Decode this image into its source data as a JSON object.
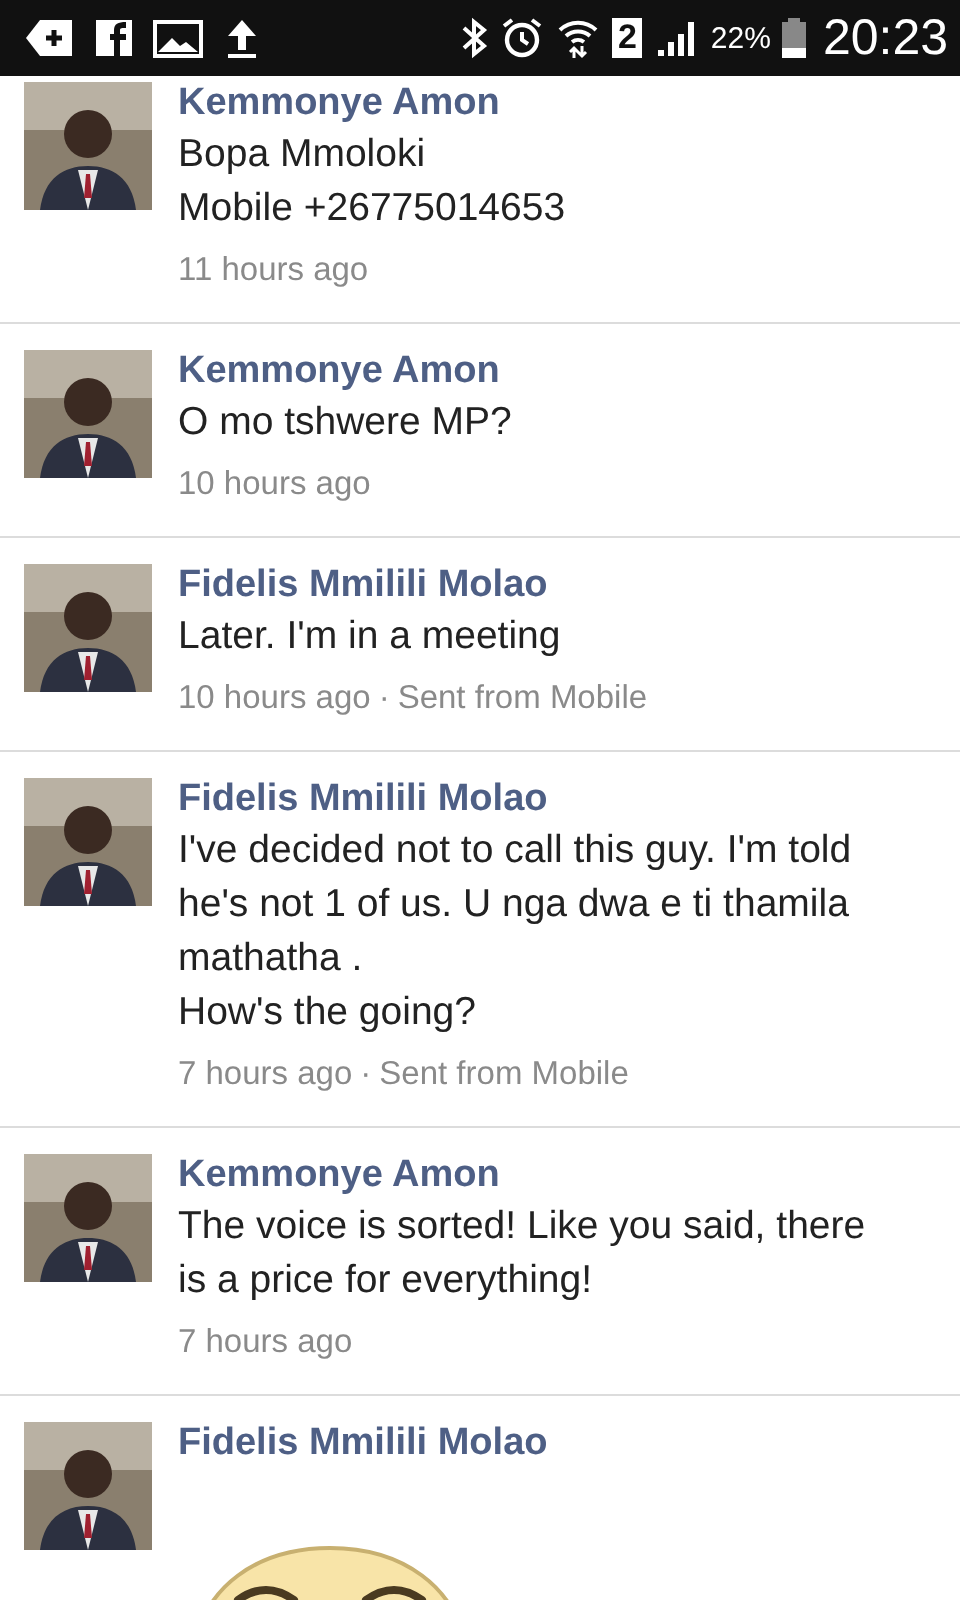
{
  "status_bar": {
    "sim": "2",
    "battery": "22%",
    "time": "20:23"
  },
  "messages": [
    {
      "kind": "text",
      "author": "Kemmonye Amon",
      "lines": [
        "Bopa Mmoloki",
        "Mobile +26775014653"
      ],
      "time": "11 hours ago"
    },
    {
      "kind": "text",
      "author": "Kemmonye Amon",
      "lines": [
        "O mo tshwere MP?"
      ],
      "time": "10 hours ago"
    },
    {
      "kind": "text",
      "author": "Fidelis Mmilili Molao",
      "lines": [
        "Later. I'm in a meeting"
      ],
      "time": "10 hours ago",
      "separator": "·",
      "source": "Sent from Mobile"
    },
    {
      "kind": "text",
      "author": "Fidelis Mmilili Molao",
      "lines": [
        "I've decided not to call this guy. I'm told he's not 1 of us. U nga dwa e ti thamila mathatha .",
        "How's the going?"
      ],
      "time": "7 hours ago",
      "separator": "·",
      "source": "Sent from Mobile"
    },
    {
      "kind": "text",
      "author": "Kemmonye Amon",
      "lines": [
        "The voice is sorted! Like you said, there is a price for everything!"
      ],
      "time": "7 hours ago"
    },
    {
      "kind": "sticker",
      "author": "Fidelis Mmilili Molao"
    }
  ]
}
